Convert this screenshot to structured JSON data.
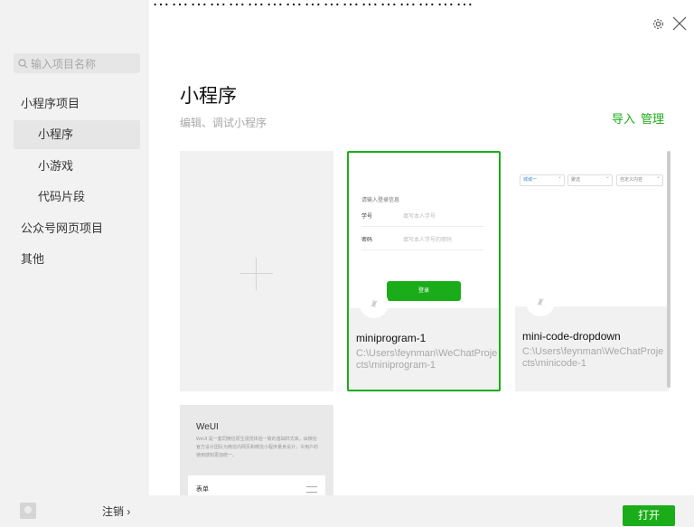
{
  "header_band": {
    "text": "…………………………………………………………………"
  },
  "sidebar": {
    "search_placeholder": "输入项目名称",
    "items": [
      {
        "label": "小程序项目"
      },
      {
        "label": "小程序"
      },
      {
        "label": "小游戏"
      },
      {
        "label": "代码片段"
      },
      {
        "label": "公众号网页项目"
      },
      {
        "label": "其他"
      }
    ],
    "logout_label": "注销 ›"
  },
  "main": {
    "title": "小程序",
    "subtitle": "编辑、调试小程序",
    "import_label": "导入",
    "manage_label": "管理",
    "projects": [
      {
        "name": "miniprogram-1",
        "path": "C:\\Users\\feynman\\WeChatProjects\\miniprogram-1",
        "preview": {
          "heading": "请输入登录信息",
          "row1_label": "学号",
          "row1_placeholder": "填写本人学号",
          "row2_label": "密码",
          "row2_placeholder": "填写本人学号的密码",
          "button": "登录"
        }
      },
      {
        "name": "mini-code-dropdown",
        "path": "C:\\Users\\feynman\\WeChatProjects\\minicode-1",
        "preview": {
          "dd1": "城城一",
          "dd2": "聚选",
          "dd3": "自定义内容"
        }
      }
    ],
    "weui": {
      "title": "WeUI",
      "desc": "WeUI 是一套同微信原生视觉体验一致的基础样式库，由微信官方设计团队为微信内网页和微信小程序量身设计，令用户的使用感知更加统一。",
      "section": "表单"
    },
    "open_label": "打开"
  },
  "colors": {
    "accent": "#1aad19",
    "sidebar_bg": "#f2f2f2"
  }
}
